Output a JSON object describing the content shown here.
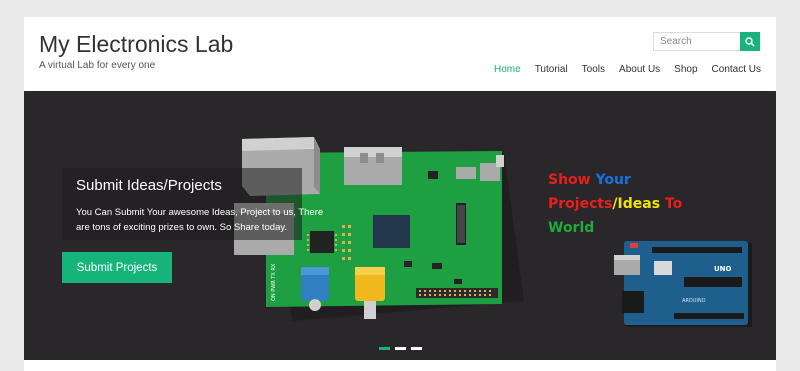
{
  "header": {
    "site_title": "My Electronics Lab",
    "tagline": "A virtual Lab for every one",
    "search_placeholder": "Search"
  },
  "nav": {
    "items": [
      {
        "label": "Home",
        "active": true
      },
      {
        "label": "Tutorial"
      },
      {
        "label": "Tools"
      },
      {
        "label": "About Us"
      },
      {
        "label": "Shop"
      },
      {
        "label": "Contact Us"
      }
    ]
  },
  "slider": {
    "caption_title": "Submit Ideas/Projects",
    "caption_text": "You Can Submit Your awesome Ideas, Project to us, There are tons of exciting prizes to own. So Share today.",
    "button_label": "Submit Projects",
    "headline": {
      "w1": "Show",
      "w2": "Your",
      "w3": "Projects",
      "w4": "/",
      "w5": "Ideas",
      "w6": "To",
      "w7": "World"
    },
    "board_labels": {
      "uno": "UNO",
      "arduino": "ARDUINO",
      "left_pins": "ON PWR TX RX"
    },
    "active_slide": 1,
    "slide_count": 3
  },
  "colors": {
    "accent": "#16b37a",
    "slider_bg": "#2a272a",
    "headline_red": "#e8201c",
    "headline_blue": "#1a6fe0",
    "headline_yellow": "#f2e600",
    "headline_green": "#1faa3c"
  },
  "icons": {
    "search": "magnifier-icon"
  }
}
